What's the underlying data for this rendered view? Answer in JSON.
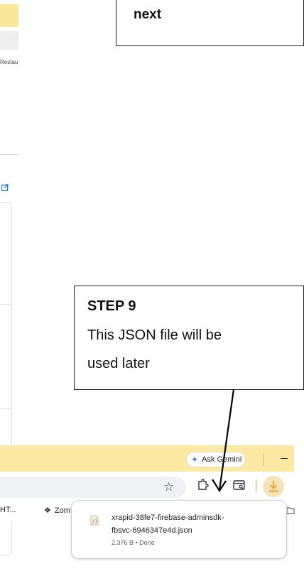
{
  "left_strip": {
    "cropped_text": "Restau"
  },
  "callouts": {
    "top": {
      "text": "next"
    },
    "step9": {
      "title": "STEP 9",
      "line1": "This JSON file will be",
      "line2": "used later"
    }
  },
  "browser": {
    "gemini_button_label": "Ask Gemini",
    "bookmarks": [
      {
        "label": "HT..."
      },
      {
        "label": "Zom"
      }
    ],
    "icons": {
      "bookmark_star": "star-icon",
      "extensions": "puzzle-icon",
      "reader": "reader-mode-icon",
      "downloads": "download-icon",
      "gemini": "sparkle-icon"
    },
    "accent_colors": {
      "tab_bar": "#fbe9a4",
      "download_accent": "#e8a33d",
      "gemini_blue": "#4b7be6"
    }
  },
  "download": {
    "filename_line1": "xrapid-38fe7-firebase-adminsdk-",
    "filename_line2": "fbsvc-6946347e4d.json",
    "status": "2,376 B • Done"
  }
}
